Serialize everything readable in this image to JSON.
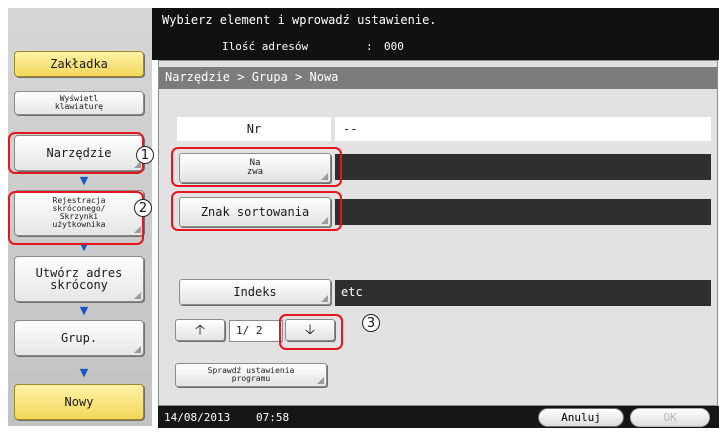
{
  "header": {
    "instruction": "Wybierz element i wprowadź ustawienie.",
    "address_count_label": "Ilość adresów",
    "address_count_sep": ":",
    "address_count_value": "000"
  },
  "sidebar": {
    "tab_label": "Zakładka",
    "keyboard_label": "Wyświetl\nklawiaturę",
    "steps": [
      {
        "label": "Narzędzie"
      },
      {
        "label": "Rejestracja\nskróconego/\nSkrzynki\nużytkownika"
      },
      {
        "label": "Utwórz adres\nskrócony"
      },
      {
        "label": "Grup."
      },
      {
        "label": "Nowy"
      }
    ],
    "flow_arrow_icon": "down-arrow-icon",
    "accent_color": "#1c56c4"
  },
  "main": {
    "breadcrumb": "Narzędzie > Grupa > Nowa",
    "no_label": "Nr",
    "no_value": "--",
    "name_button": "Na\nzwa",
    "name_value": "",
    "sort_button": "Znak sortowania",
    "sort_value": "",
    "index_button": "Indeks",
    "index_value": "etc",
    "page_indicator": "1/ 2",
    "up_icon": "up-arrow-icon",
    "down_icon": "down-arrow-icon",
    "check_program_button": "Sprawdź ustawienia\nprogramu"
  },
  "footer": {
    "date": "14/08/2013",
    "time": "07:58",
    "cancel": "Anuluj",
    "ok": "OK"
  },
  "annotations": {
    "callout_1": "1",
    "callout_2": "2",
    "callout_3": "3",
    "highlight_color": "#e8141e"
  }
}
